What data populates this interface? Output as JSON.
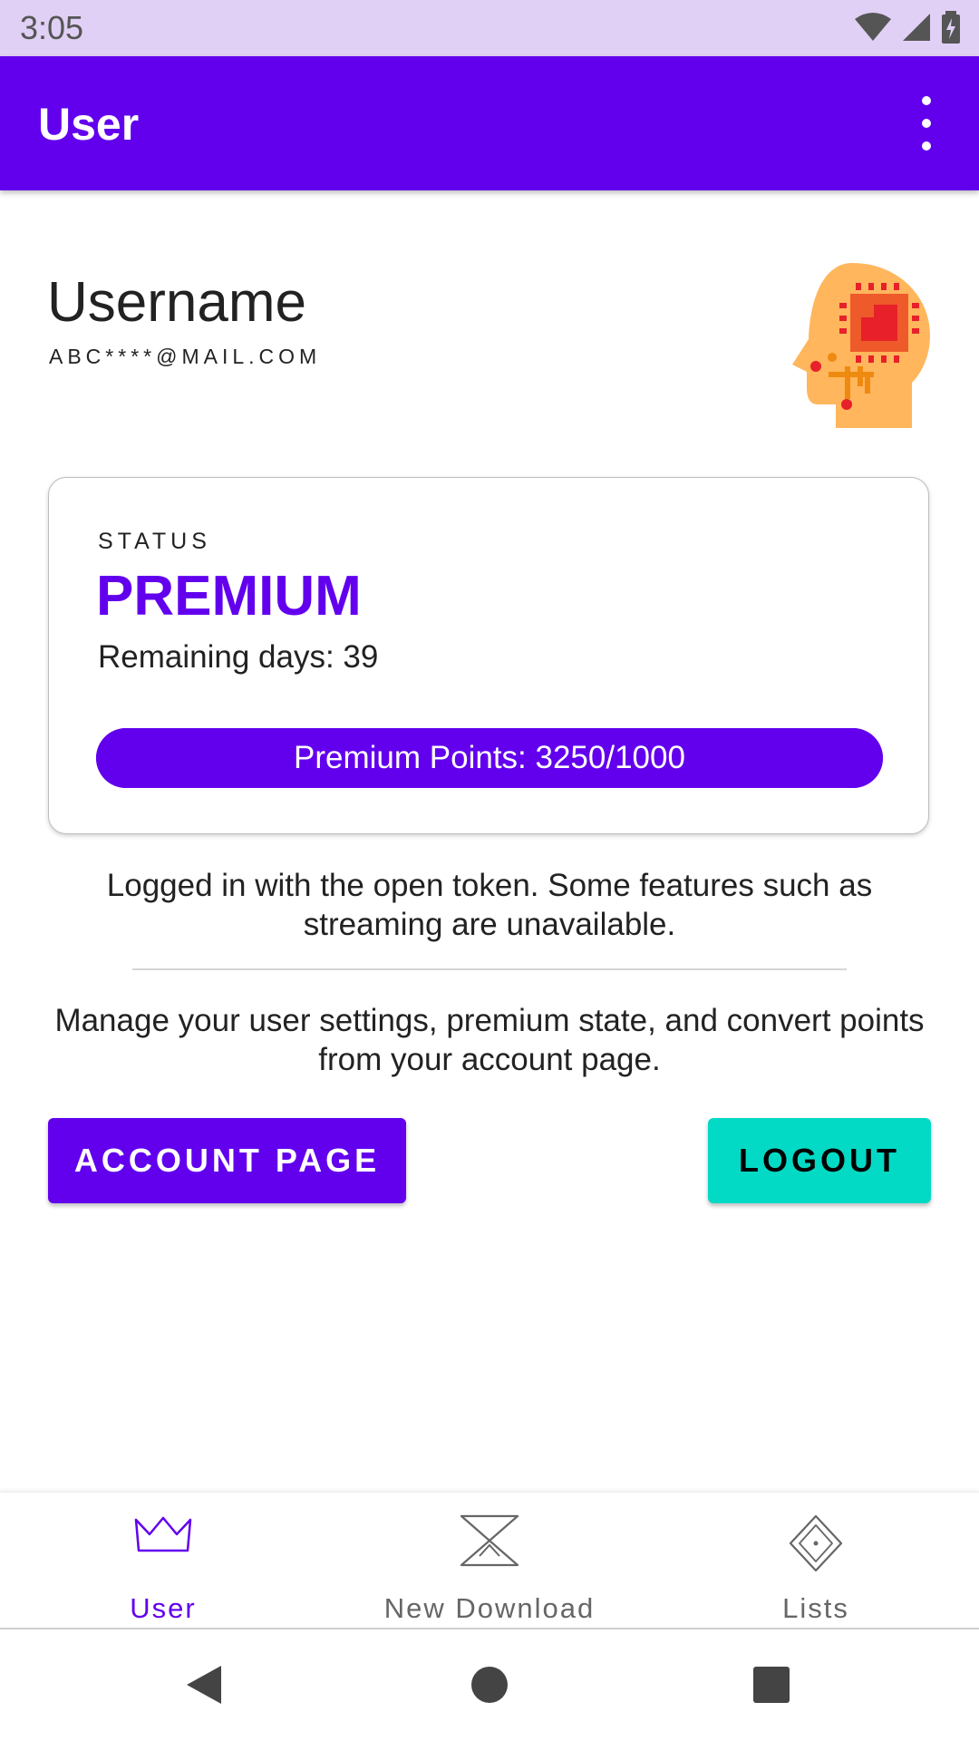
{
  "status_bar": {
    "time": "3:05",
    "icons": [
      "wifi-icon",
      "signal-icon",
      "battery-icon"
    ]
  },
  "app_bar": {
    "title": "User",
    "menu_icon": "more-vert-icon"
  },
  "profile": {
    "username": "Username",
    "email": "ABC****@MAIL.COM",
    "avatar_icon": "ai-head-icon"
  },
  "status_card": {
    "label": "STATUS",
    "value": "PREMIUM",
    "remaining": "Remaining days: 39",
    "points_text": "Premium Points: 3250/1000",
    "points_fill_fraction": 1.0
  },
  "info": {
    "login_notice": "Logged in with the open token. Some features such as streaming are unavailable.",
    "manage_text": "Manage your user settings, premium state, and convert points from your account page."
  },
  "buttons": {
    "account_page": "ACCOUNT PAGE",
    "logout": "LOGOUT"
  },
  "bottom_nav": {
    "items": [
      {
        "label": "User",
        "icon": "crown-icon",
        "active": true
      },
      {
        "label": "New Download",
        "icon": "hourglass-icon",
        "active": false
      },
      {
        "label": "Lists",
        "icon": "diamond-icon",
        "active": false
      }
    ]
  },
  "system_nav": {
    "icons": [
      "back-icon",
      "home-icon",
      "recents-icon"
    ]
  },
  "colors": {
    "primary": "#6200ee",
    "secondary": "#03dac5",
    "status_bar": "#e0d0f5"
  }
}
